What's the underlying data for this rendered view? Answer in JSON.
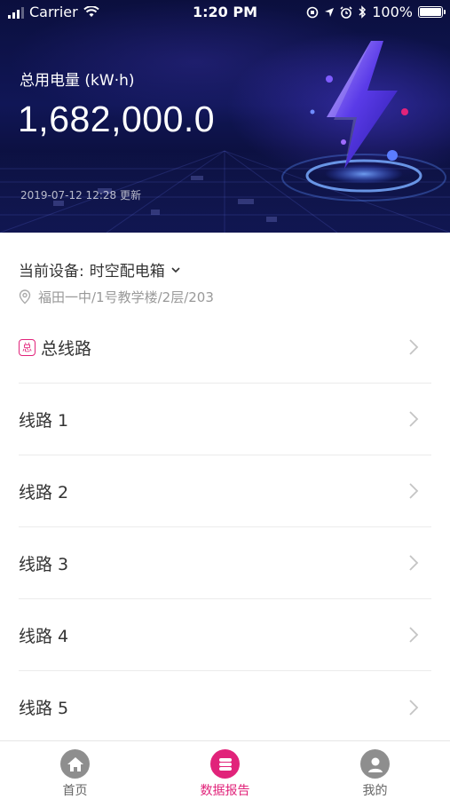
{
  "status_bar": {
    "carrier": "Carrier",
    "time": "1:20 PM",
    "battery": "100%",
    "battery_level": 1.0
  },
  "header": {
    "energy_label": "总用电量 (kW·h)",
    "energy_value": "1,682,000.0",
    "updated": "2019-07-12 12:28 更新"
  },
  "device": {
    "label": "当前设备:",
    "name": "时空配电箱",
    "location": "福田一中/1号教学楼/2层/203"
  },
  "circuits": {
    "total_badge": "总",
    "items": [
      "总线路",
      "线路 1",
      "线路 2",
      "线路 3",
      "线路 4",
      "线路 5"
    ]
  },
  "tabbar": {
    "items": [
      "首页",
      "数据报告",
      "我的"
    ],
    "active_index": 1
  },
  "colors": {
    "accent": "#e1237a",
    "header_bg": "#0f1350",
    "inactive_icon": "#8e8e8e"
  },
  "icons": [
    "wifi-icon",
    "signal-icon",
    "bluetooth-icon",
    "alarm-icon",
    "location-arrow-icon",
    "lightning-icon",
    "location-pin-icon",
    "chevron-right-icon",
    "home-icon",
    "data-report-icon",
    "profile-icon"
  ]
}
